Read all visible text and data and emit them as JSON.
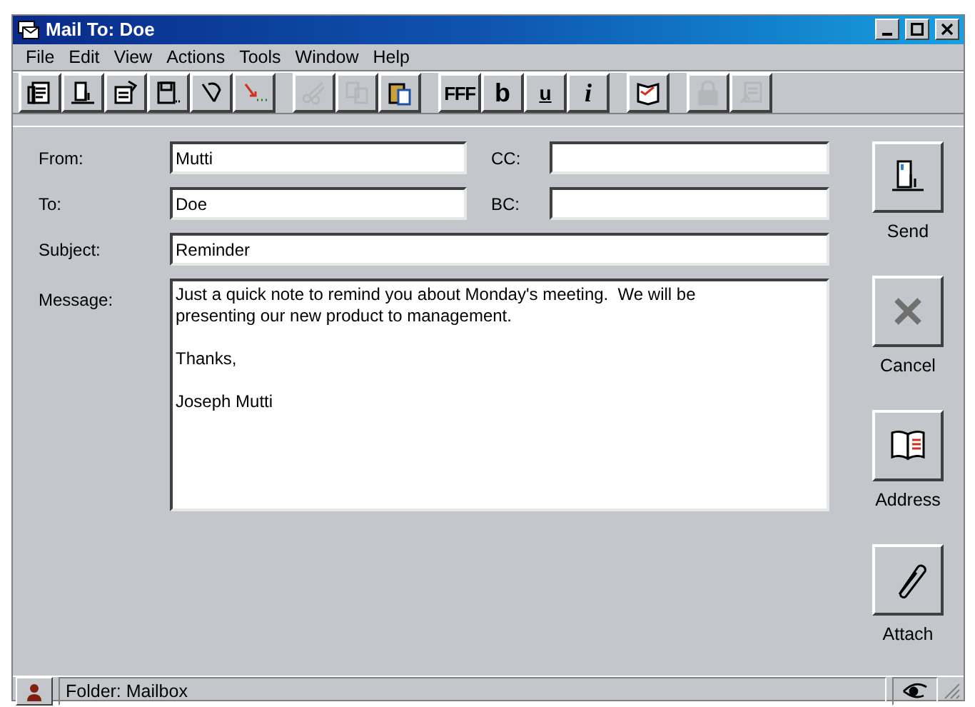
{
  "window": {
    "title": "Mail To: Doe"
  },
  "menu": [
    {
      "label": "File"
    },
    {
      "label": "Edit"
    },
    {
      "label": "View"
    },
    {
      "label": "Actions"
    },
    {
      "label": "Tools"
    },
    {
      "label": "Window"
    },
    {
      "label": "Help"
    }
  ],
  "toolbar": [
    [
      {
        "kind": "icon",
        "disabled": false
      },
      {
        "kind": "icon",
        "disabled": false
      },
      {
        "kind": "icon",
        "disabled": false
      },
      {
        "kind": "icon",
        "disabled": false
      },
      {
        "kind": "icon",
        "disabled": false
      },
      {
        "kind": "icon",
        "disabled": false
      }
    ],
    [
      {
        "kind": "icon",
        "disabled": true
      },
      {
        "kind": "icon",
        "disabled": true
      },
      {
        "kind": "icon",
        "disabled": false
      }
    ],
    [
      {
        "kind": "text",
        "text": "FFF",
        "disabled": false
      },
      {
        "kind": "text",
        "text": "b",
        "disabled": false
      },
      {
        "kind": "text",
        "text": "u",
        "disabled": false
      },
      {
        "kind": "text",
        "text": "i",
        "disabled": false
      }
    ],
    [
      {
        "kind": "icon",
        "disabled": false
      }
    ],
    [
      {
        "kind": "icon",
        "disabled": true
      },
      {
        "kind": "icon",
        "disabled": true
      }
    ]
  ],
  "fields": {
    "from": {
      "label": "From:",
      "value": "Mutti"
    },
    "cc": {
      "label": "CC:"
    },
    "to": {
      "label": "To:",
      "value": "Doe"
    },
    "bc": {
      "label": "BC:"
    },
    "subject": {
      "label": "Subject:",
      "value": "Reminder"
    },
    "message": {
      "label": "Message:",
      "value": "Just a quick note to remind you about Monday's meeting.  We will be\npresenting our new product to management.\n\nThanks,\n\nJoseph Mutti"
    }
  },
  "actions": [
    {
      "label": "Send"
    },
    {
      "label": "Cancel"
    },
    {
      "label": "Address"
    },
    {
      "label": "Attach"
    }
  ],
  "status_bar": {
    "text": "Folder: Mailbox"
  }
}
